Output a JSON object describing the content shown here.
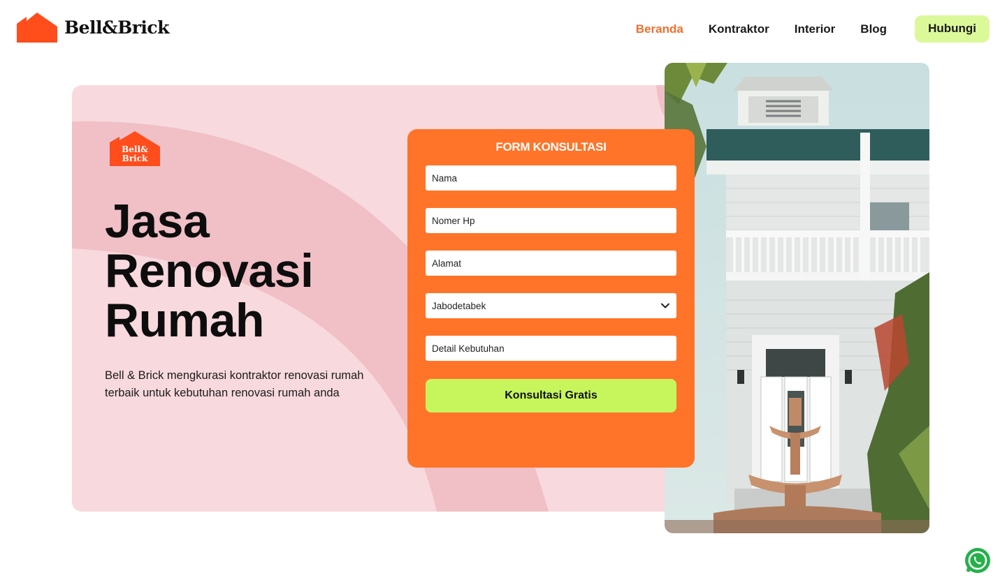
{
  "brand": {
    "name": "Bell&Brick",
    "badge_line1": "Bell&",
    "badge_line2": "Brick"
  },
  "nav": {
    "items": [
      {
        "label": "Beranda",
        "active": true
      },
      {
        "label": "Kontraktor",
        "active": false
      },
      {
        "label": "Interior",
        "active": false
      },
      {
        "label": "Blog",
        "active": false
      }
    ],
    "cta_label": "Hubungi"
  },
  "hero": {
    "title_lines": [
      "Jasa",
      "Renovasi",
      "Rumah"
    ],
    "description": "Bell & Brick mengkurasi kontraktor renovasi rumah terbaik untuk kebutuhan renovasi rumah anda"
  },
  "form": {
    "title": "FORM KONSULTASI",
    "name_placeholder": "Nama",
    "phone_placeholder": "Nomer Hp",
    "address_placeholder": "Alamat",
    "region_selected": "Jabodetabek",
    "needs_placeholder": "Detail Kebutuhan",
    "submit_label": "Konsultasi Gratis"
  },
  "colors": {
    "accent_orange": "#ff7429",
    "nav_active": "#f26e2e",
    "lime": "#c7f65c",
    "hero_bg": "#f8d9de",
    "hero_arc": "#f0c0c6"
  },
  "icons": {
    "logo": "house-roof-icon",
    "select": "chevron-down-icon",
    "floating": "whatsapp-icon"
  }
}
